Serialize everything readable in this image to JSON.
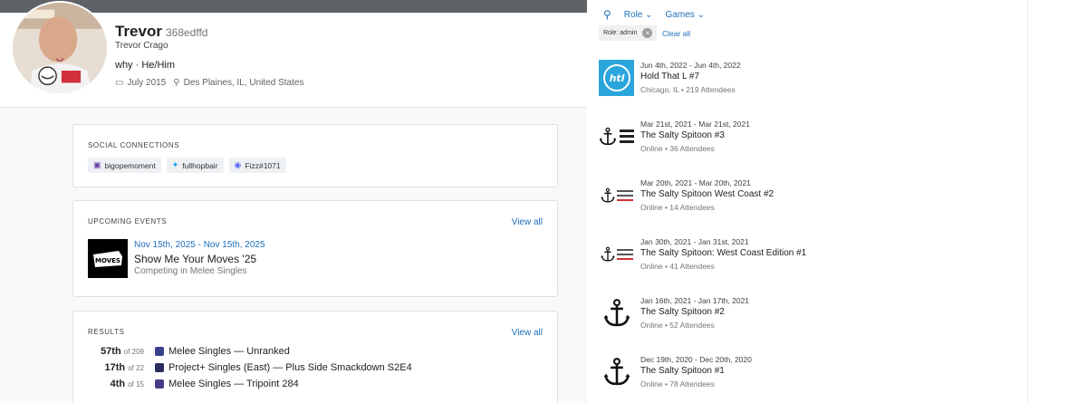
{
  "profile": {
    "name": "Trevor",
    "tag": "368edffd",
    "real_name": "Trevor Crago",
    "bio": "why · He/Him",
    "joined": "July 2015",
    "location": "Des Plaines, IL, United States"
  },
  "social": {
    "title": "SOCIAL CONNECTIONS",
    "items": [
      {
        "label": "bigopemoment",
        "icon": "twitch-icon"
      },
      {
        "label": "fullhopbair",
        "icon": "twitter-icon"
      },
      {
        "label": "Fizz#1071",
        "icon": "discord-icon"
      }
    ]
  },
  "upcoming": {
    "title": "UPCOMING EVENTS",
    "view_all": "View all",
    "event": {
      "date": "Nov 15th, 2025 - Nov 15th, 2025",
      "name": "Show Me Your Moves '25",
      "sub": "Competing in Melee Singles",
      "thumb_text": "MOVES"
    }
  },
  "results": {
    "title": "RESULTS",
    "view_all": "View all",
    "rows": [
      {
        "place": "57th",
        "of": "of 209",
        "event": "Melee Singles — Unranked",
        "color": "#3a3f8f"
      },
      {
        "place": "17th",
        "of": "of 22",
        "event": "Project+ Singles (East) — Plus Side Smackdown S2E4",
        "color": "#2b2d5e"
      },
      {
        "place": "4th",
        "of": "of 15",
        "event": "Melee Singles — Tripoint 284",
        "color": "#4b3a8a"
      }
    ]
  },
  "filters": {
    "role": "Role",
    "games": "Games",
    "chip": "Role: admin",
    "clear": "Clear all"
  },
  "tournaments": [
    {
      "date": "Jun 4th, 2022 - Jun 4th, 2022",
      "name": "Hold That L #7",
      "location": "Chicago, IL",
      "attendees": "219 Attendees",
      "thumb": "htl"
    },
    {
      "date": "Mar 21st, 2021 - Mar 21st, 2021",
      "name": "The Salty Spitoon #3",
      "location": "Online",
      "attendees": "36 Attendees",
      "thumb": "anchor-text"
    },
    {
      "date": "Mar 20th, 2021 - Mar 20th, 2021",
      "name": "The Salty Spitoon West Coast #2",
      "location": "Online",
      "attendees": "14 Attendees",
      "thumb": "anchor-small"
    },
    {
      "date": "Jan 30th, 2021 - Jan 31st, 2021",
      "name": "The Salty Spitoon: West Coast Edition #1",
      "location": "Online",
      "attendees": "41 Attendees",
      "thumb": "anchor-small"
    },
    {
      "date": "Jan 16th, 2021 - Jan 17th, 2021",
      "name": "The Salty Spitoon #2",
      "location": "Online",
      "attendees": "52 Attendees",
      "thumb": "anchor"
    },
    {
      "date": "Dec 19th, 2020 - Dec 20th, 2020",
      "name": "The Salty Spitoon #1",
      "location": "Online",
      "attendees": "78 Attendees",
      "thumb": "anchor"
    }
  ],
  "colors": {
    "link": "#1e6fb8",
    "htl_blue": "#2aa6dc"
  }
}
